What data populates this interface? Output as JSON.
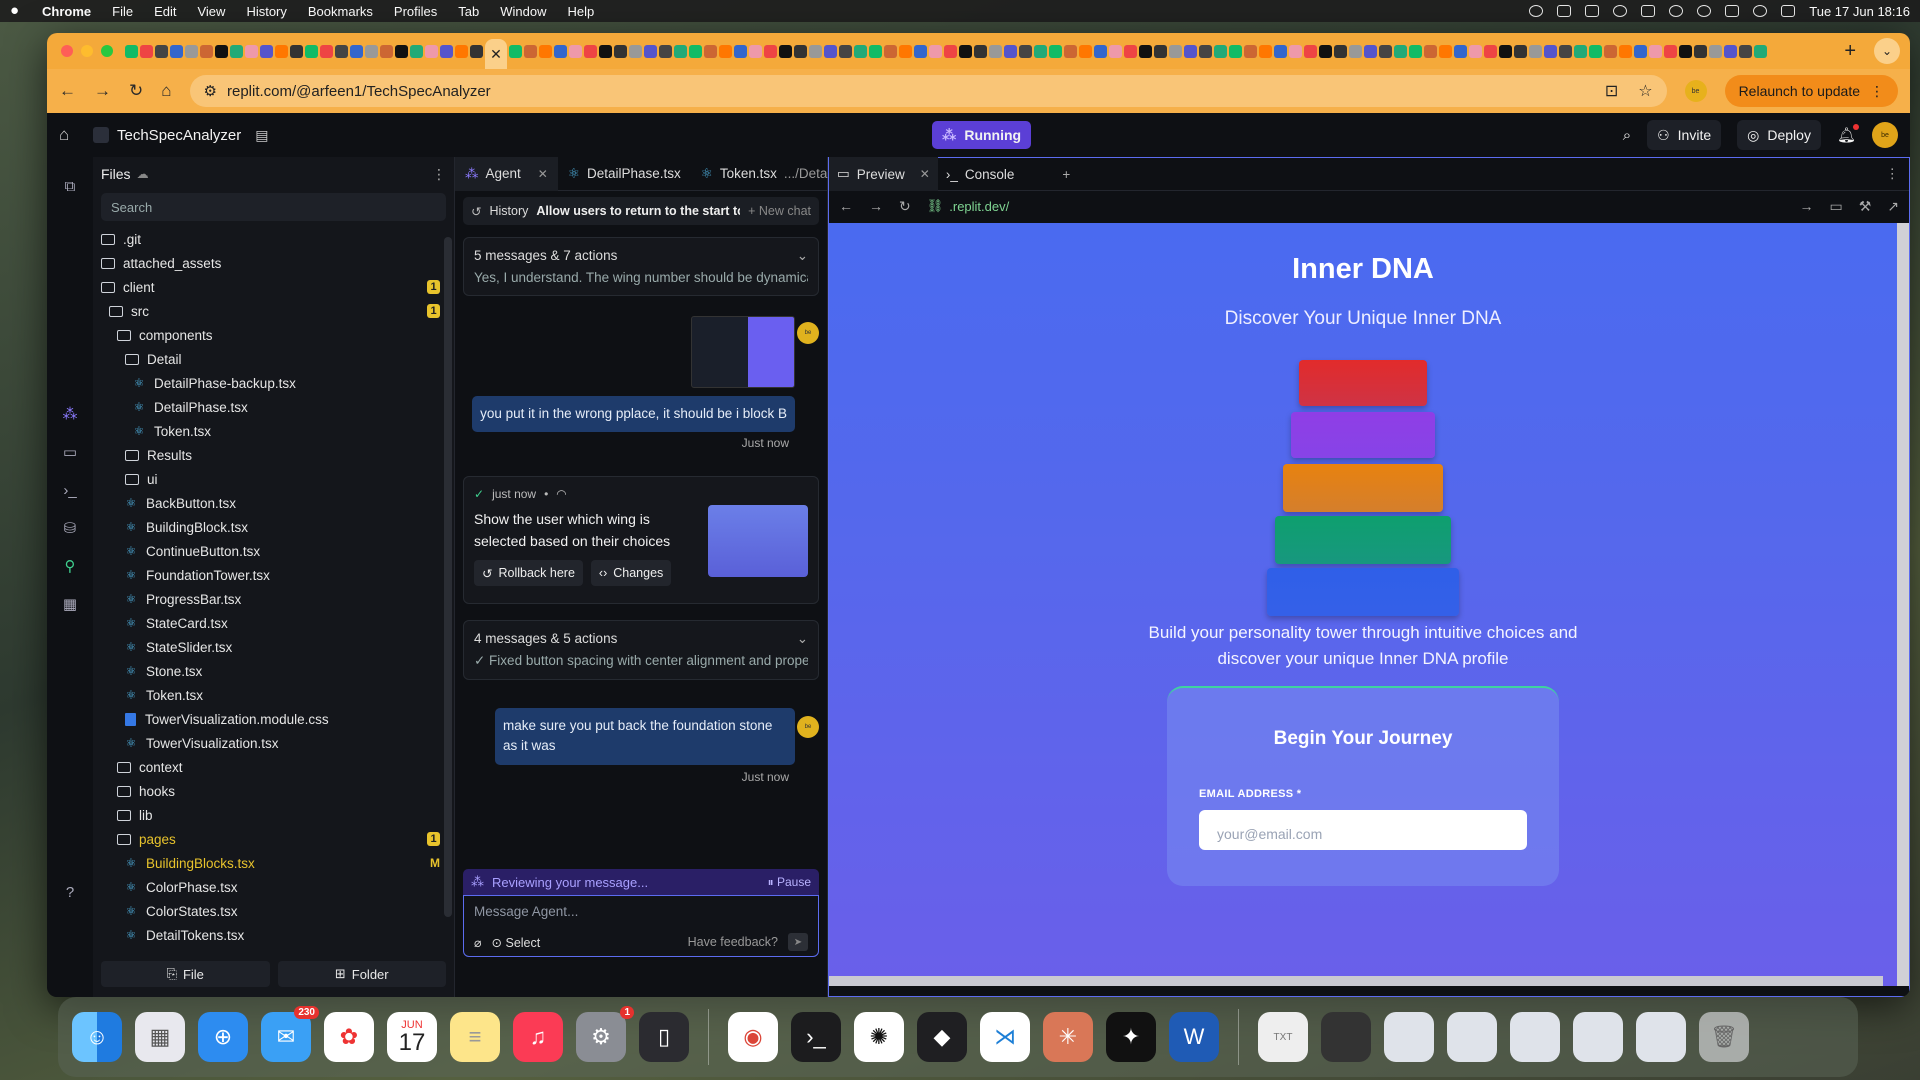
{
  "menubar": {
    "app": "Chrome",
    "items": [
      "File",
      "Edit",
      "View",
      "History",
      "Bookmarks",
      "Profiles",
      "Tab",
      "Window",
      "Help"
    ],
    "clock": "Tue 17 Jun  18:16"
  },
  "browser": {
    "url": "replit.com/@arfeen1/TechSpecAnalyzer",
    "relaunch_label": "Relaunch to update",
    "tab_close": "✕"
  },
  "replit": {
    "project_name": "TechSpecAnalyzer",
    "running_label": "Running",
    "invite_label": "Invite",
    "deploy_label": "Deploy"
  },
  "files": {
    "title": "Files",
    "search_placeholder": "Search",
    "new_file_label": "File",
    "new_folder_label": "Folder",
    "tree": [
      {
        "name": ".git",
        "type": "folder",
        "depth": 0
      },
      {
        "name": "attached_assets",
        "type": "folder",
        "depth": 0
      },
      {
        "name": "client",
        "type": "folder-open",
        "depth": 0,
        "badge": "1"
      },
      {
        "name": "src",
        "type": "folder-open",
        "depth": 1,
        "badge": "1"
      },
      {
        "name": "components",
        "type": "folder-open",
        "depth": 2
      },
      {
        "name": "Detail",
        "type": "folder-open",
        "depth": 3
      },
      {
        "name": "DetailPhase-backup.tsx",
        "type": "tsx",
        "depth": 4
      },
      {
        "name": "DetailPhase.tsx",
        "type": "tsx",
        "depth": 4
      },
      {
        "name": "Token.tsx",
        "type": "tsx",
        "depth": 4
      },
      {
        "name": "Results",
        "type": "folder",
        "depth": 3
      },
      {
        "name": "ui",
        "type": "folder",
        "depth": 3
      },
      {
        "name": "BackButton.tsx",
        "type": "tsx",
        "depth": 3
      },
      {
        "name": "BuildingBlock.tsx",
        "type": "tsx",
        "depth": 3
      },
      {
        "name": "ContinueButton.tsx",
        "type": "tsx",
        "depth": 3
      },
      {
        "name": "FoundationTower.tsx",
        "type": "tsx",
        "depth": 3
      },
      {
        "name": "ProgressBar.tsx",
        "type": "tsx",
        "depth": 3
      },
      {
        "name": "StateCard.tsx",
        "type": "tsx",
        "depth": 3
      },
      {
        "name": "StateSlider.tsx",
        "type": "tsx",
        "depth": 3
      },
      {
        "name": "Stone.tsx",
        "type": "tsx",
        "depth": 3
      },
      {
        "name": "Token.tsx",
        "type": "tsx",
        "depth": 3
      },
      {
        "name": "TowerVisualization.module.css",
        "type": "css",
        "depth": 3
      },
      {
        "name": "TowerVisualization.tsx",
        "type": "tsx",
        "depth": 3
      },
      {
        "name": "context",
        "type": "folder",
        "depth": 2
      },
      {
        "name": "hooks",
        "type": "folder",
        "depth": 2
      },
      {
        "name": "lib",
        "type": "folder",
        "depth": 2
      },
      {
        "name": "pages",
        "type": "folder-open",
        "depth": 2,
        "badge": "1",
        "modified": true
      },
      {
        "name": "BuildingBlocks.tsx",
        "type": "tsx",
        "depth": 3,
        "mbadge": "M",
        "modified": true
      },
      {
        "name": "ColorPhase.tsx",
        "type": "tsx",
        "depth": 3
      },
      {
        "name": "ColorStates.tsx",
        "type": "tsx",
        "depth": 3
      },
      {
        "name": "DetailTokens.tsx",
        "type": "tsx",
        "depth": 3
      }
    ]
  },
  "agent": {
    "tabs": [
      {
        "label": "Agent"
      },
      {
        "label": "DetailPhase.tsx"
      },
      {
        "label": "Token.tsx",
        "path": ".../Deta"
      }
    ],
    "history_label": "History",
    "history_title": "Allow users to return to the start to reasse...",
    "new_chat_label": "New chat",
    "summary1": {
      "title": "5 messages & 7 actions",
      "text": "Yes, I understand. The wing number should be dynamically c..."
    },
    "user_msg1": "you put it in the wrong pplace, it should be i block B",
    "ts1": "Just now",
    "checkpoint": {
      "time": "just now",
      "message": "Show the user which wing is selected based on their choices",
      "rollback_label": "Rollback here",
      "changes_label": "Changes"
    },
    "summary2": {
      "title": "4 messages & 5 actions",
      "text": "✓ Fixed button spacing with center alignment and proper ga..."
    },
    "user_msg2": "make sure you put back the foundation stone as it was",
    "ts2": "Just now",
    "reviewing": "Reviewing your message...",
    "pause_label": "Pause",
    "composer_placeholder": "Message Agent...",
    "select_label": "Select",
    "feedback_label": "Have feedback?"
  },
  "preview": {
    "tabs": [
      {
        "label": "Preview"
      },
      {
        "label": "Console"
      }
    ],
    "url": ".replit.dev/",
    "app": {
      "title": "Inner DNA",
      "subtitle": "Discover Your Unique Inner DNA",
      "description": "Build your personality tower through intuitive choices and discover your unique Inner DNA profile",
      "card_title": "Begin Your Journey",
      "email_label": "EMAIL ADDRESS *",
      "email_placeholder": "your@email.com"
    },
    "tower_colors": [
      "#e22b2b",
      "#8f3ee6",
      "#e8820f",
      "#0e9f6e",
      "#2f5fe8"
    ]
  },
  "dock": {
    "mail_badge": "230",
    "settings_badge": "1",
    "calendar_month": "JUN",
    "calendar_day": "17"
  }
}
